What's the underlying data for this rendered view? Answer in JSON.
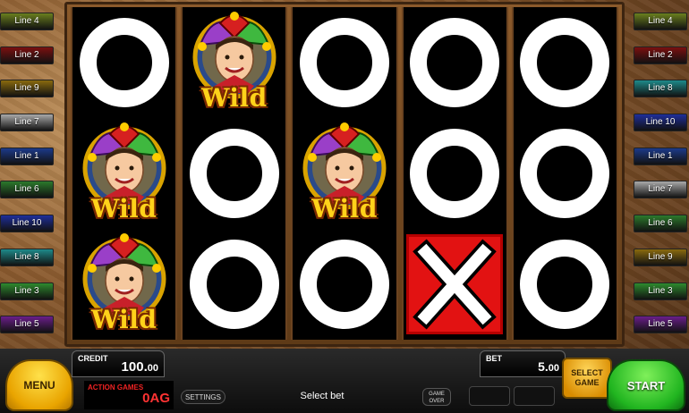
{
  "left_lines": [
    {
      "label": "Line 4",
      "color": "#6a7f1e"
    },
    {
      "label": "Line 2",
      "color": "#7a1010"
    },
    {
      "label": "Line 9",
      "color": "#8a6a0e"
    },
    {
      "label": "Line 7",
      "color": "#a9a9a9"
    },
    {
      "label": "Line 1",
      "color": "#1c3a8a"
    },
    {
      "label": "Line 6",
      "color": "#2c7a2c"
    },
    {
      "label": "Line 10",
      "color": "#1e2e9a"
    },
    {
      "label": "Line 8",
      "color": "#1e8a8a"
    },
    {
      "label": "Line 3",
      "color": "#2e8a2e"
    },
    {
      "label": "Line 5",
      "color": "#6a1e8a"
    }
  ],
  "right_lines": [
    {
      "label": "Line 4",
      "color": "#6a7f1e"
    },
    {
      "label": "Line 2",
      "color": "#7a1010"
    },
    {
      "label": "Line 8",
      "color": "#1e8a8a"
    },
    {
      "label": "Line 10",
      "color": "#1e2e9a"
    },
    {
      "label": "Line 1",
      "color": "#1c3a8a"
    },
    {
      "label": "Line 7",
      "color": "#a9a9a9"
    },
    {
      "label": "Line 6",
      "color": "#2c7a2c"
    },
    {
      "label": "Line 9",
      "color": "#8a6a0e"
    },
    {
      "label": "Line 3",
      "color": "#2e8a2e"
    },
    {
      "label": "Line 5",
      "color": "#6a1e8a"
    }
  ],
  "reels": [
    [
      "ring",
      "wild",
      "wild"
    ],
    [
      "wild",
      "ring",
      "ring"
    ],
    [
      "ring",
      "wild",
      "ring"
    ],
    [
      "ring",
      "ring",
      "x"
    ],
    [
      "ring",
      "ring",
      "ring"
    ]
  ],
  "wild_label": "Wild",
  "controls": {
    "menu": "MENU",
    "start": "START",
    "select_game": "SELECT GAME",
    "credit_label": "CREDIT",
    "credit_value_main": "100.",
    "credit_value_cents": "00",
    "action_games_label": "ACTION GAMES",
    "action_games_value": "0AG",
    "settings": "SETTINGS",
    "message": "Select bet",
    "game_over": "GAME OVER",
    "bet_label": "BET",
    "bet_value_main": "5.",
    "bet_value_cents": "00"
  },
  "colors": {
    "symbol_x": "#e21212",
    "wild_text": "#ffd21a",
    "start_green": "#21b520",
    "menu_gold": "#e9a400"
  }
}
